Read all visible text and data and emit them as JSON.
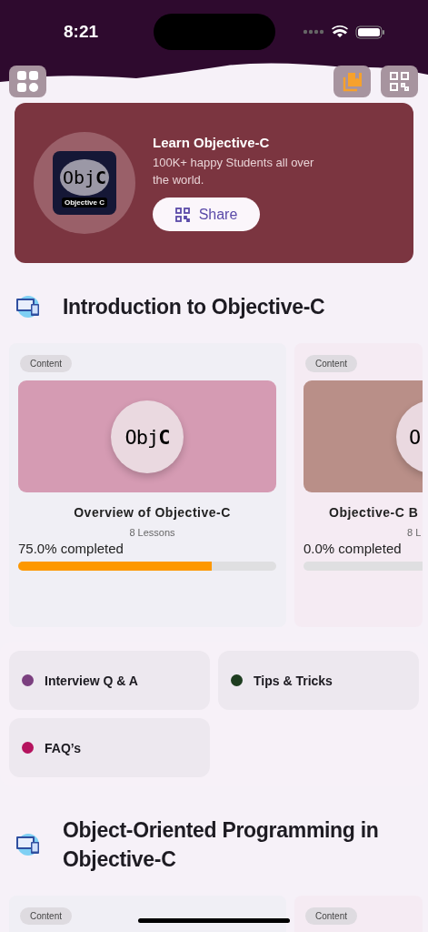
{
  "status_bar": {
    "time": "8:21"
  },
  "banner": {
    "title": "Learn Objective-C",
    "subtitle": "100K+ happy Students all over the world.",
    "logo_text": "Obj**C**",
    "logo_caption": "Objective C",
    "share_label": "Share"
  },
  "sections": [
    {
      "title": "Introduction to Objective-C",
      "cards": [
        {
          "kind": "full",
          "tag": "Content",
          "color": "#d59bb3",
          "logo": "Obj**C**",
          "title": "Overview of Objective-C",
          "lessons": "8 Lessons",
          "progress_text": "75.0% completed",
          "level": 0.75
        },
        {
          "kind": "partial",
          "tag": "Content",
          "color": "#b98f88",
          "logo": "O",
          "title": "Objective-C B",
          "lessons": "8 L",
          "progress_text": "0.0% completed"
        }
      ]
    },
    {
      "title": "Object-Oriented Programming in Objective-C",
      "cards": [
        {
          "kind": "full",
          "tag": "Content"
        },
        {
          "kind": "partial",
          "tag": "Content"
        }
      ]
    }
  ],
  "quick_links": [
    {
      "label": "Interview Q & A",
      "color": "#7b3f7f"
    },
    {
      "label": "Tips & Tricks",
      "color": "#1e3d20"
    },
    {
      "label": "FAQ’s",
      "color": "#b5135e"
    }
  ]
}
